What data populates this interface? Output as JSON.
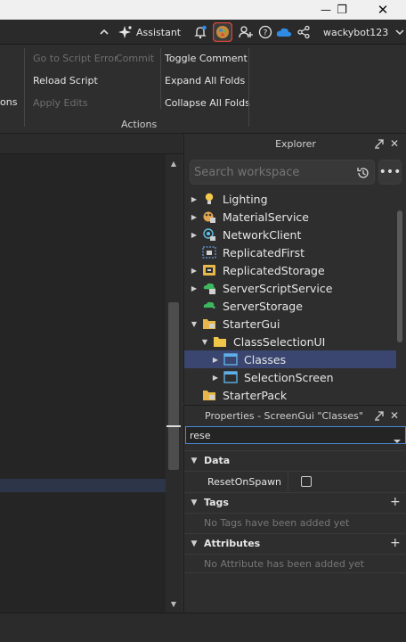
{
  "titlebar": {
    "minimize": "—",
    "restore": "❐",
    "close": "✕"
  },
  "topbar": {
    "collapse_icon": "chevron-up-icon",
    "assistant_label": "Assistant",
    "username": "wackybot123"
  },
  "ribbon": {
    "col0": {
      "ons_label": "ons"
    },
    "col1": {
      "go_to_error": "Go to Script Error",
      "commit": "Commit",
      "reload_script": "Reload Script",
      "apply_edits": "Apply Edits"
    },
    "col2": {
      "toggle_comment": "Toggle Comment",
      "expand_all": "Expand All Folds",
      "collapse_all": "Collapse All Folds"
    },
    "group_label": "Actions"
  },
  "explorer": {
    "title": "Explorer",
    "search_placeholder": "Search workspace",
    "items": [
      {
        "label": "Lighting",
        "icon": "lighting-icon",
        "caret": "▶"
      },
      {
        "label": "MaterialService",
        "icon": "material-service-icon",
        "caret": "▶"
      },
      {
        "label": "NetworkClient",
        "icon": "network-client-icon",
        "caret": "▶"
      },
      {
        "label": "ReplicatedFirst",
        "icon": "replicated-first-icon",
        "caret": ""
      },
      {
        "label": "ReplicatedStorage",
        "icon": "replicated-storage-icon",
        "caret": "▶"
      },
      {
        "label": "ServerScriptService",
        "icon": "server-script-service-icon",
        "caret": "▶"
      },
      {
        "label": "ServerStorage",
        "icon": "server-storage-icon",
        "caret": ""
      },
      {
        "label": "StarterGui",
        "icon": "starter-gui-icon",
        "caret": "▼"
      },
      {
        "label": "ClassSelectionUI",
        "icon": "folder-icon",
        "caret": "▼"
      },
      {
        "label": "Classes",
        "icon": "screen-gui-icon",
        "caret": "▶"
      },
      {
        "label": "SelectionScreen",
        "icon": "screen-gui-icon",
        "caret": "▶"
      },
      {
        "label": "StarterPack",
        "icon": "starter-pack-icon",
        "caret": ""
      }
    ]
  },
  "properties": {
    "title": "Properties - ScreenGui \"Classes\"",
    "filter_value": "rese",
    "sections": {
      "data": {
        "label": "Data",
        "property": "ResetOnSpawn"
      },
      "tags": {
        "label": "Tags",
        "empty": "No Tags have been added yet"
      },
      "attributes": {
        "label": "Attributes",
        "empty": "No Attribute has been added yet"
      }
    }
  },
  "colors": {
    "selection": "#3a4670",
    "accent": "#4a8ad8",
    "cloud": "#2f8be6"
  }
}
